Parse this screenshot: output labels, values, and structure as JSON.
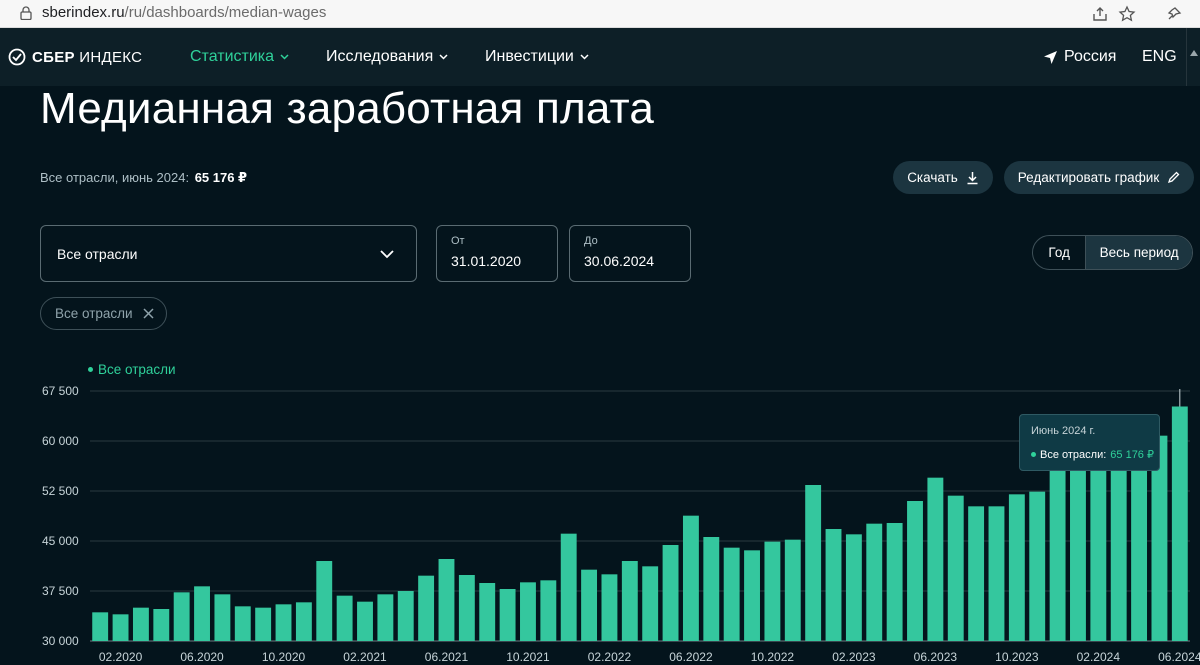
{
  "browser": {
    "url_host": "sberindex.ru",
    "url_path": "/ru/dashboards/median-wages"
  },
  "nav": {
    "logo_bold": "СБЕР",
    "logo_thin": "ИНДЕКС",
    "items": [
      {
        "label": "Статистика",
        "active": true
      },
      {
        "label": "Исследования",
        "active": false
      },
      {
        "label": "Инвестиции",
        "active": false
      }
    ],
    "region": "Россия",
    "lang": "ENG"
  },
  "page": {
    "title": "Медианная заработная плата",
    "summary_label": "Все отрасли, июнь 2024:",
    "summary_value": "65 176 ₽",
    "download_label": "Скачать",
    "edit_label": "Редактировать график"
  },
  "filters": {
    "industry_value": "Все отрасли",
    "from_label": "От",
    "from_value": "31.01.2020",
    "to_label": "До",
    "to_value": "30.06.2024",
    "period_year": "Год",
    "period_all": "Весь период",
    "chip_label": "Все отрасли"
  },
  "tooltip": {
    "title": "Июнь 2024 г.",
    "series": "Все отрасли:",
    "value": "65 176 ₽"
  },
  "colors": {
    "accent": "#2fd19a",
    "bar": "#34c79e",
    "background": "#04141c"
  },
  "chart_data": {
    "type": "bar",
    "legend": "Все отрасли",
    "ylim": [
      30000,
      67500
    ],
    "yticks": [
      30000,
      37500,
      45000,
      52500,
      60000,
      67500
    ],
    "ytick_labels": [
      "30 000",
      "37 500",
      "45 000",
      "52 500",
      "60 000",
      "67 500"
    ],
    "x_tick_labels": [
      "02.2020",
      "06.2020",
      "10.2020",
      "02.2021",
      "06.2021",
      "10.2021",
      "02.2022",
      "06.2022",
      "10.2022",
      "02.2023",
      "06.2023",
      "10.2023",
      "02.2024",
      "06.2024"
    ],
    "x_tick_every": 4,
    "x_tick_offset": 0,
    "grid": true,
    "categories": [
      "01.2020",
      "02.2020",
      "03.2020",
      "04.2020",
      "05.2020",
      "06.2020",
      "07.2020",
      "08.2020",
      "09.2020",
      "10.2020",
      "11.2020",
      "12.2020",
      "01.2021",
      "02.2021",
      "03.2021",
      "04.2021",
      "05.2021",
      "06.2021",
      "07.2021",
      "08.2021",
      "09.2021",
      "10.2021",
      "11.2021",
      "12.2021",
      "01.2022",
      "02.2022",
      "03.2022",
      "04.2022",
      "05.2022",
      "06.2022",
      "07.2022",
      "08.2022",
      "09.2022",
      "10.2022",
      "11.2022",
      "12.2022",
      "01.2023",
      "02.2023",
      "03.2023",
      "04.2023",
      "05.2023",
      "06.2023",
      "07.2023",
      "08.2023",
      "09.2023",
      "10.2023",
      "11.2023",
      "12.2023",
      "01.2024",
      "02.2024",
      "03.2024",
      "04.2024",
      "05.2024",
      "06.2024"
    ],
    "values": [
      34300,
      34000,
      35000,
      34800,
      37300,
      38200,
      37000,
      35200,
      35000,
      35500,
      35800,
      42000,
      36800,
      35900,
      37000,
      37500,
      39800,
      42300,
      39900,
      38700,
      37800,
      38800,
      39100,
      46100,
      40700,
      40000,
      42000,
      41200,
      44400,
      48800,
      45600,
      44000,
      43600,
      44900,
      45200,
      53400,
      46800,
      46000,
      47600,
      47700,
      51000,
      54500,
      51800,
      50200,
      50200,
      52000,
      52400,
      55500,
      56000,
      56200,
      57000,
      58100,
      60800,
      65176
    ]
  }
}
